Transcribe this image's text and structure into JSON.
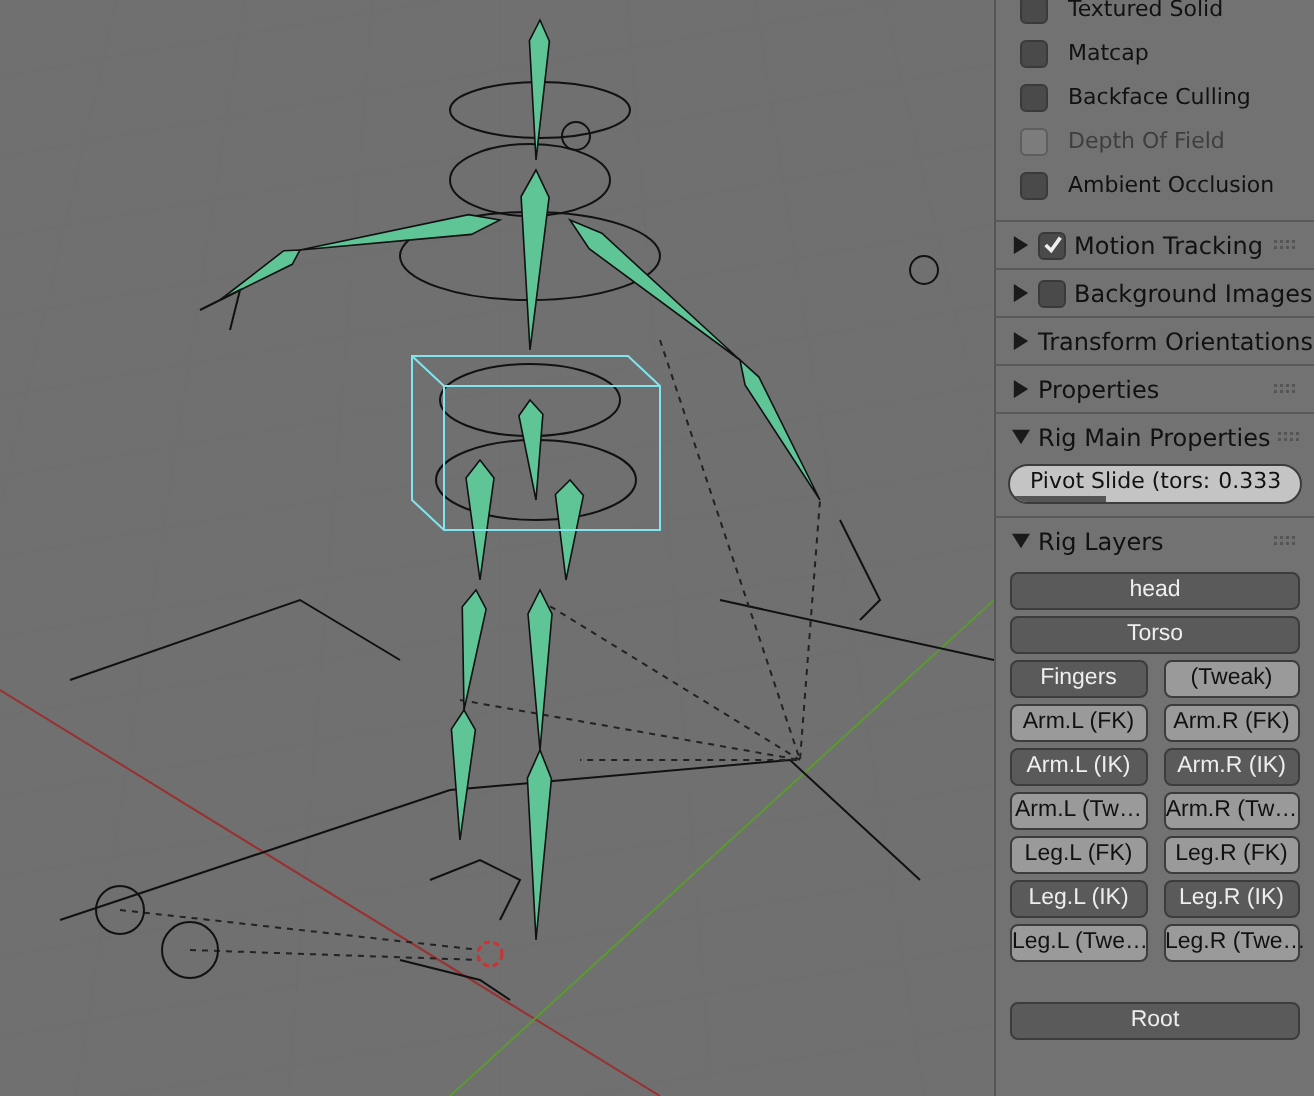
{
  "display_options": [
    {
      "label": "Textured Solid",
      "checked": false,
      "disabled": false
    },
    {
      "label": "Matcap",
      "checked": false,
      "disabled": false
    },
    {
      "label": "Backface Culling",
      "checked": false,
      "disabled": false
    },
    {
      "label": "Depth Of Field",
      "checked": false,
      "disabled": true
    },
    {
      "label": "Ambient Occlusion",
      "checked": false,
      "disabled": false
    }
  ],
  "panels": [
    {
      "title": "Motion Tracking",
      "expanded": false,
      "kind": "checkbox",
      "checked": true
    },
    {
      "title": "Background Images",
      "expanded": false,
      "kind": "checkbox",
      "checked": false
    },
    {
      "title": "Transform Orientations",
      "expanded": false,
      "kind": "plain"
    },
    {
      "title": "Properties",
      "expanded": false,
      "kind": "plain"
    }
  ],
  "rig_main_properties": {
    "title": "Rig Main Properties",
    "expanded": true,
    "slider": {
      "label": "Pivot Slide (tors:",
      "value": "0.333",
      "level": 0.333
    }
  },
  "rig_layers": {
    "title": "Rig Layers",
    "expanded": true,
    "rows": [
      [
        {
          "label": "head",
          "selected": true
        }
      ],
      [
        {
          "label": "Torso",
          "selected": true
        }
      ],
      [
        {
          "label": "Fingers",
          "selected": true
        },
        {
          "label": "(Tweak)",
          "selected": false
        }
      ],
      [
        {
          "label": "Arm.L (FK)",
          "selected": false
        },
        {
          "label": "Arm.R (FK)",
          "selected": false
        }
      ],
      [
        {
          "label": "Arm.L (IK)",
          "selected": true
        },
        {
          "label": "Arm.R (IK)",
          "selected": true
        }
      ],
      [
        {
          "label": "Arm.L (Tw…",
          "selected": false
        },
        {
          "label": "Arm.R (Tw…",
          "selected": false
        }
      ],
      [
        {
          "label": "Leg.L (FK)",
          "selected": false
        },
        {
          "label": "Leg.R (FK)",
          "selected": false
        }
      ],
      [
        {
          "label": "Leg.L (IK)",
          "selected": true
        },
        {
          "label": "Leg.R (IK)",
          "selected": true
        }
      ],
      [
        {
          "label": "Leg.L (Twe…",
          "selected": false
        },
        {
          "label": "Leg.R (Twe…",
          "selected": false
        }
      ]
    ],
    "root": {
      "label": "Root",
      "selected": true
    }
  }
}
